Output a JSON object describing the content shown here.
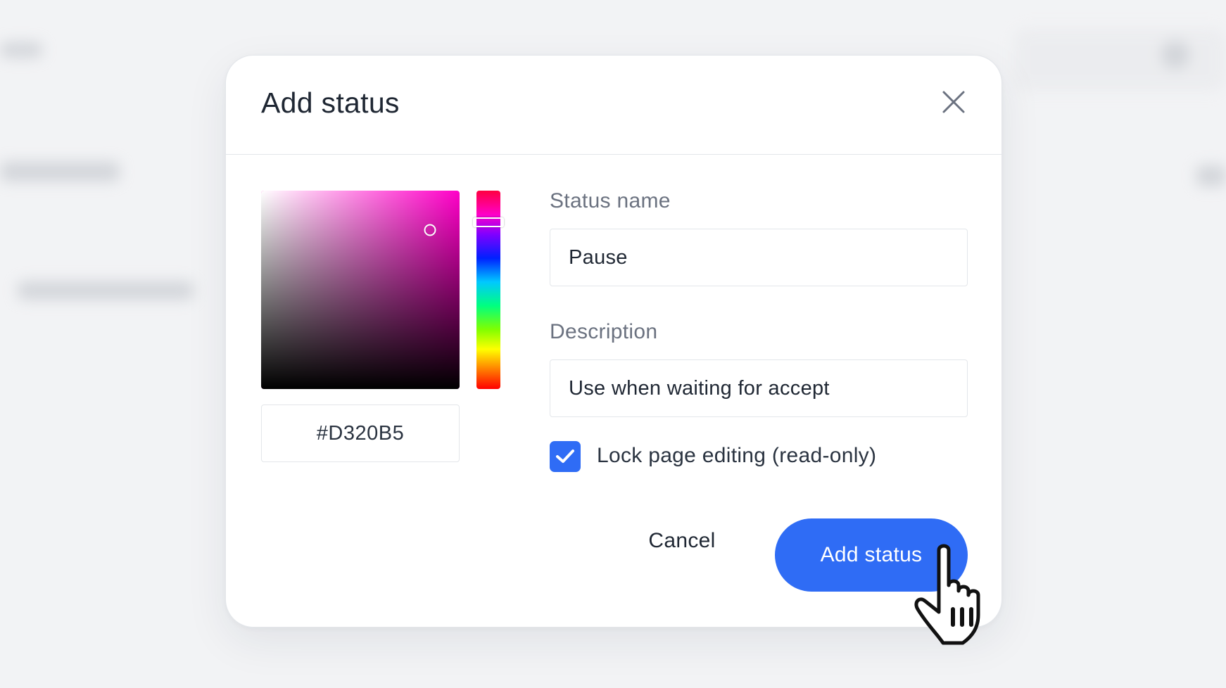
{
  "dialog": {
    "title": "Add status",
    "close_icon": "close-icon"
  },
  "color_picker": {
    "hex_value": "#D320B5",
    "selected_color": "#D320B5",
    "hue_color": "#ff00c8",
    "saturation": 0.85,
    "brightness": 0.8,
    "hue_position": 0.16
  },
  "form": {
    "status_name": {
      "label": "Status name",
      "value": "Pause"
    },
    "description": {
      "label": "Description",
      "value": "Use when waiting for accept"
    },
    "lock_editing": {
      "label": "Lock page editing (read-only)",
      "checked": true
    }
  },
  "actions": {
    "cancel_label": "Cancel",
    "submit_label": "Add status"
  },
  "colors": {
    "accent": "#2f6cf5",
    "title_text": "#1f2733",
    "label_text": "#6b7280",
    "border": "#e3e6ea"
  },
  "cursor_icon": "pointing-hand-cursor-icon"
}
